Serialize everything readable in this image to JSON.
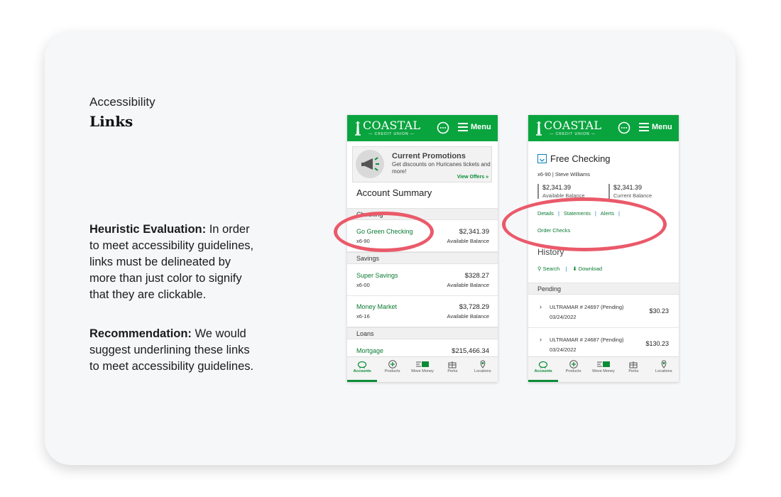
{
  "intro": {
    "eyebrow": "Accessibility",
    "title": "Links"
  },
  "heuristic": {
    "label": "Heuristic Evaluation:",
    "text": " In order to meet accessibility guidelines, links must be delineated by more than just color to signify that they are clickable."
  },
  "recommendation": {
    "label": "Recommendation:",
    "text": " We would suggest underlining these links to meet accessibility guidelines."
  },
  "brand": {
    "name": "COASTAL",
    "sub": "— CREDIT UNION —",
    "menu_label": "Menu",
    "green": "#0aa43f",
    "highlight": "#ea5a6a"
  },
  "screen1": {
    "promo": {
      "title": "Current Promotions",
      "desc": "Get discounts on Huricanes tickets and more!",
      "link": "View Offers"
    },
    "summary_title": "Account Summary",
    "sections": {
      "checking": "Checking",
      "savings": "Savings",
      "loans": "Loans"
    },
    "accounts": [
      {
        "name": "Go Green Checking",
        "number": "x6-90",
        "amount": "$2,341.39",
        "label": "Available Balance"
      },
      {
        "name": "Super Savings",
        "number": "x6-00",
        "amount": "$328.27",
        "label": "Available Balance"
      },
      {
        "name": "Money Market",
        "number": "x6-16",
        "amount": "$3,728.29",
        "label": "Available Balance"
      },
      {
        "name": "Mortgage",
        "number": "",
        "amount": "$215,466.34",
        "label": ""
      }
    ]
  },
  "screen2": {
    "account_title": "Free Checking",
    "account_sub": "x6-90 | Steve Williams",
    "balances": [
      {
        "amount": "$2,341.39",
        "label": "Available Balance"
      },
      {
        "amount": "$2,341.39",
        "label": "Current Balance"
      }
    ],
    "links": [
      "Details",
      "Statements",
      "Alerts"
    ],
    "order_checks": "Order Checks",
    "history_title": "History",
    "history_links": [
      "Search",
      "Download"
    ],
    "pending_label": "Pending",
    "pending": [
      {
        "name": "ULTRAMAR # 24697 (Pending)",
        "date": "03/24/2022",
        "amount": "$30.23"
      },
      {
        "name": "ULTRAMAR # 24687 (Pending)",
        "date": "03/24/2022",
        "amount": "$130.23"
      }
    ]
  },
  "tabs": [
    "Accounts",
    "Products",
    "Move Money",
    "Perks",
    "Locations"
  ]
}
